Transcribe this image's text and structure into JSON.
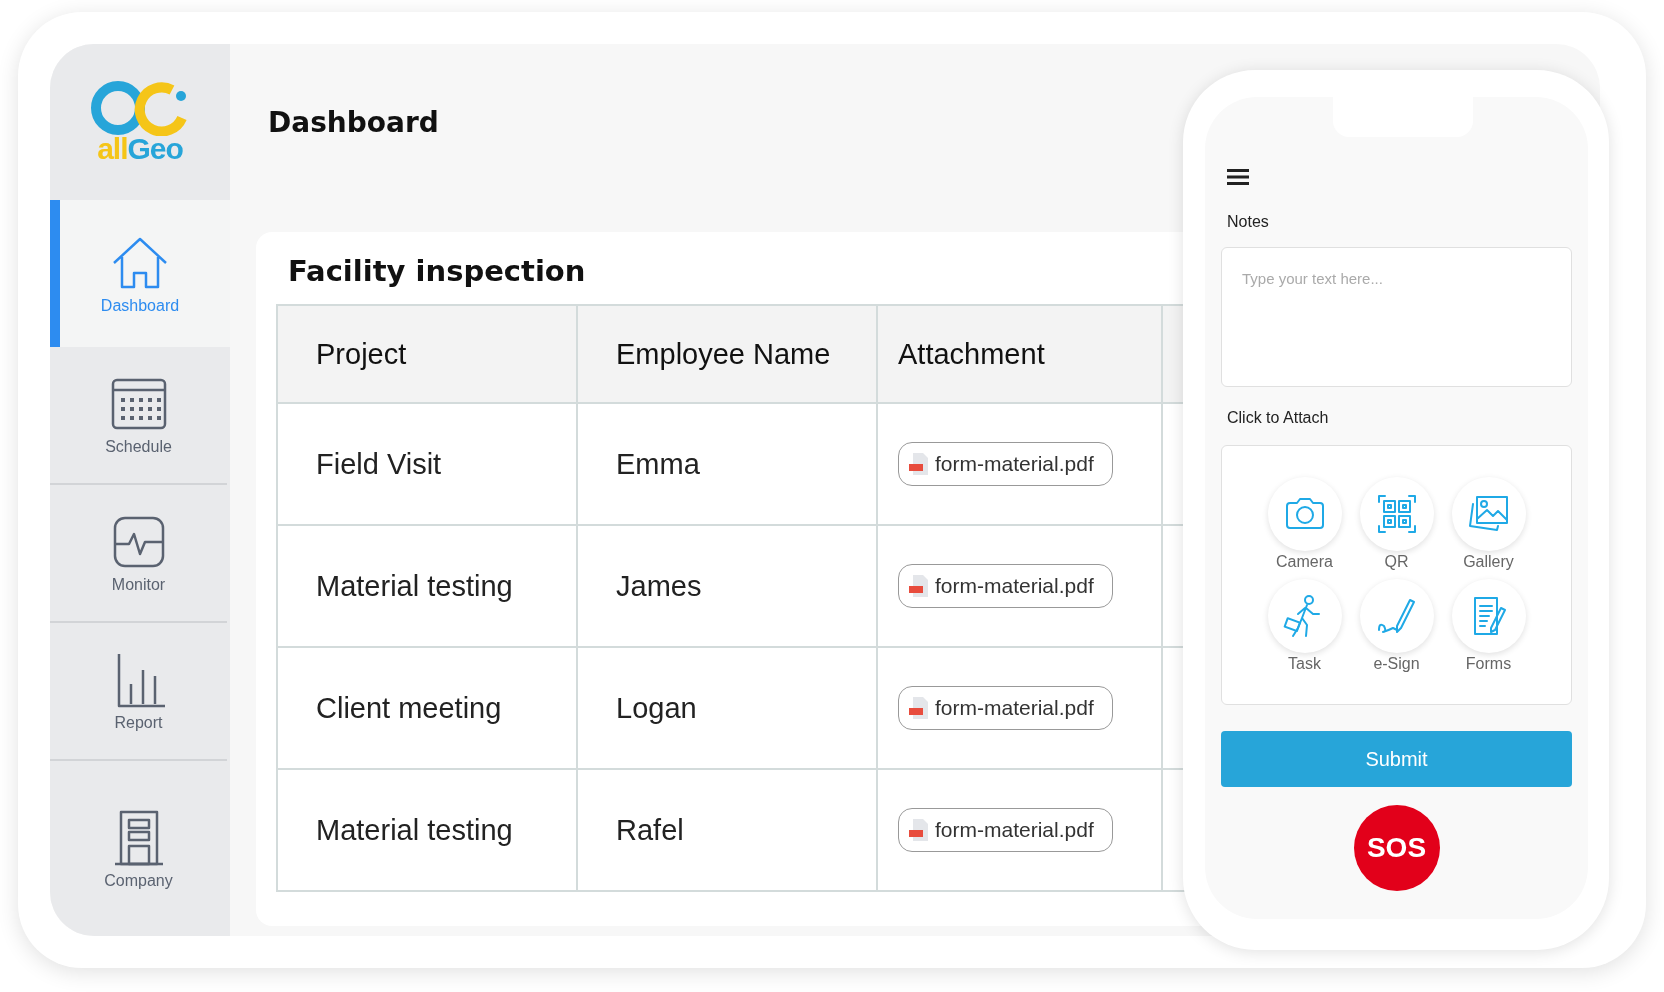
{
  "logo": {
    "parts": [
      "all",
      "Geo"
    ]
  },
  "sidebar": {
    "items": [
      {
        "label": "Dashboard",
        "selected": true
      },
      {
        "label": "Schedule",
        "selected": false
      },
      {
        "label": "Monitor",
        "selected": false
      },
      {
        "label": "Report",
        "selected": false
      },
      {
        "label": "Company",
        "selected": false
      }
    ]
  },
  "header": {
    "title": "Dashboard"
  },
  "card": {
    "title": "Facility inspection"
  },
  "table": {
    "columns": [
      "Project",
      "Employee Name",
      "Attachment"
    ],
    "rows": [
      {
        "project": "Field Visit",
        "employee": "Emma",
        "attachment": "form-material.pdf"
      },
      {
        "project": "Material testing",
        "employee": "James",
        "attachment": "form-material.pdf"
      },
      {
        "project": "Client meeting",
        "employee": "Logan",
        "attachment": "form-material.pdf"
      },
      {
        "project": "Material testing",
        "employee": "Rafel",
        "attachment": "form-material.pdf"
      }
    ]
  },
  "phone": {
    "notes_label": "Notes",
    "notes": {
      "placeholder": "Type your text here..."
    },
    "attach_label": "Click to Attach",
    "attach_options": [
      {
        "label": "Camera"
      },
      {
        "label": "QR"
      },
      {
        "label": "Gallery"
      },
      {
        "label": "Task"
      },
      {
        "label": "e-Sign"
      },
      {
        "label": "Forms"
      }
    ],
    "submit": "Submit",
    "sos": "SOS"
  }
}
